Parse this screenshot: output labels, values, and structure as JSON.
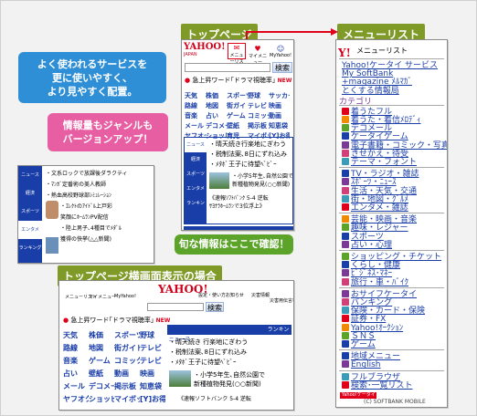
{
  "labels": {
    "top_page": "トップページ",
    "menu_list": "メニューリスト",
    "landscape": "トップページ横画面表示の場合"
  },
  "callouts": {
    "blue": [
      "よく使われるサービスを",
      "更に使いやすく、",
      "より見やすく配置。"
    ],
    "pink": [
      "情報量もジャンルも",
      "バージョンアップ！"
    ],
    "green": "旬な情報はここで確認！"
  },
  "yahoo": {
    "logo": "YAHOO!",
    "sub": "JAPAN",
    "menu_list_icon": "メニューリスト",
    "my_menu": "マイメニュー",
    "my_yahoo": "MyYahoo!",
    "search_button": "検索",
    "new_badge": "NEW",
    "trending": "急上昇ワード｢ドラマ視聴率｣"
  },
  "top_grid": [
    [
      "天気",
      "株価",
      "スポーツ",
      "野球",
      "サッカー"
    ],
    [
      "路線",
      "地図",
      "街ガイド",
      "テレビ",
      "映画"
    ],
    [
      "音楽",
      "占い",
      "ゲーム",
      "コミック",
      "動画"
    ],
    [
      "メール",
      "デコメール",
      "壁紙",
      "掲示板",
      "知恵袋"
    ],
    [
      "ヤフオク",
      "ショッピング",
      "育児",
      "マイボックス",
      "[Y]お得"
    ]
  ],
  "top_news": {
    "tabs": [
      "ニュース",
      "経済",
      "スポーツ",
      "エンタメ",
      "ランキング"
    ],
    "items": [
      "・晴天続き行楽地にぎわう",
      "・税制法案､8日にずれ込み",
      "・ﾒﾀﾎﾞ王子に待望ﾍﾞﾋﾞｰ"
    ],
    "photo_caption": [
      "・小学5年生､自然公園で",
      "新種植物発見(○○新聞)"
    ],
    "link1": "《速報ｿﾌﾄﾊﾞﾝｸ 5-4 逆転",
    "link2": "ｻﾖﾅﾗﾎｰﾑﾗﾝで3位浮上》"
  },
  "top_bottom_bar": [
    "災害情報",
    "設定・使い方",
    "お知らせ"
  ],
  "side_news": {
    "tabs": [
      "ニュース",
      "経済",
      "スポーツ",
      "エンタメ",
      "ランキング"
    ],
    "items": [
      "・文系ロックで放課後ダラクティ",
      "・ﾏﾝｶﾞ定番術の美人教師",
      "・熱血高校野球部ｼﾐｭﾚｰｼｮﾝ",
      "・ｴﾚｸﾄのｱｲﾄﾞﾙ上戸彩",
      "笑顔にﾎｰﾑﾗﾝPV配信",
      "・陸上男子､4種目でﾒﾀﾞﾙ",
      "獲得の快挙(△△新聞)"
    ]
  },
  "menu_list": {
    "title": "メニューリスト",
    "items_top": [
      "Yahoo!ケータイ サービス",
      "My SoftBank",
      "+magazine ﾒﾙﾏｶﾞ",
      "とくする情報局"
    ],
    "category_label": "カテゴリ",
    "cat1": [
      "着うたフル",
      "着うた・着信ﾒﾛﾃﾞｨ",
      "デコメール",
      "ケータイゲーム",
      "電子書籍・コミック・写真集",
      "きせかえ・待受",
      "テーマ・フォント"
    ],
    "cat2": [
      "TV・ラジオ・雑誌",
      "ｽﾎﾟｰﾂ・ﾆｭｰｽ",
      "生活・天気・交通",
      "街・地図・ｸﾞﾙﾒ",
      "エンタメ・雑誌"
    ],
    "cat3": [
      "芸能・映画・音楽",
      "趣味・レジャー",
      "スポーツ",
      "占い・心理"
    ],
    "cat4": [
      "ショッピング・チケット",
      "くらし・健康",
      "ﾋﾞｼﾞﾈｽ･ﾏﾈｰ",
      "旅行・車・ﾊﾞｲｸ"
    ],
    "cat5": [
      "おサイフケータイ",
      "バンキング",
      "保険・カード・保険",
      "証券・FX",
      "Yahoo!ｵｰｸｼｮﾝ",
      "ＳＮＳ",
      "ゲーム"
    ],
    "cat6": [
      "地域メニュー",
      "English"
    ],
    "cat7": [
      "フルブラウザ",
      "検索･一覧リスト"
    ],
    "footer_logo": "Yahoo!ケータイ",
    "copyright": "(C) SOFTBANK MOBILE"
  },
  "land": {
    "left_grid": [
      [
        "天気",
        "株価",
        "スポーツ",
        "野球"
      ],
      [
        "路線",
        "地図",
        "街ガイド",
        "テレビ"
      ],
      [
        "音楽",
        "ゲーム",
        "コミック",
        "テレビ"
      ],
      [
        "占い",
        "壁紙",
        "動画",
        "映画"
      ],
      [
        "メール",
        "デコメール",
        "掲示板",
        "知恵袋"
      ],
      [
        "ヤフオク",
        "ショッピング",
        "マイボックス",
        "[Y]お得"
      ]
    ],
    "header_links": [
      "メニューリスト",
      "マイメニュー",
      "MyYahoo!",
      "設定・使い方",
      "お知らせ",
      "災害情報",
      "災害用伝言板"
    ],
    "tabs": [
      "ニュース",
      "経済",
      "スポーツ",
      "エンタメ",
      "ランキング"
    ],
    "items": [
      "・晴天続き 行楽地にぎわう",
      "・税制法案､8日にずれ込み",
      "・ﾒﾀﾎﾞ王子に待望ﾍﾞﾋﾞｰ"
    ],
    "caption": [
      "・小学5年生､自然公園で",
      "新種植物発見(○○新聞)"
    ],
    "news_link": "《速報ソフトバンク 5-4 逆転"
  },
  "colors": {
    "label_green": "#7f9a27",
    "callout_blue": "#2f8fd6",
    "callout_pink": "#e85ea3",
    "red_arrow": "#e0001a",
    "tab_blue": "#1a3ea8",
    "yahoo_red": "#d0021b"
  }
}
